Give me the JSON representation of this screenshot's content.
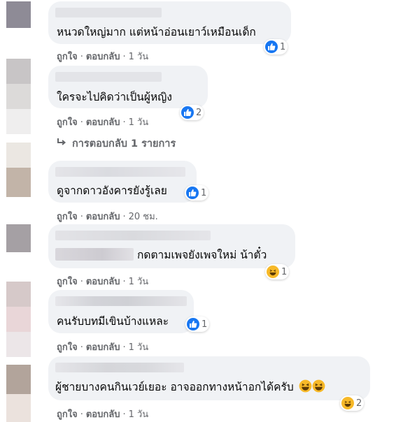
{
  "comments": [
    {
      "text": "หนวดใหญ่มาก แต่หน้าอ่อนเยาว์เหมือนเด็ก",
      "reaction": {
        "icon": "like-icon",
        "count": "1"
      },
      "actions": {
        "like": "ถูกใจ",
        "reply": "ตอบกลับ",
        "time": "1 วัน"
      }
    },
    {
      "text": "ใครจะไปคิดว่าเป็นผู้หญิง",
      "reaction": {
        "icon": "like-icon",
        "count": "2"
      },
      "actions": {
        "like": "ถูกใจ",
        "reply": "ตอบกลับ",
        "time": "1 วัน"
      },
      "replies_link": "การตอบกลับ 1 รายการ"
    },
    {
      "text": "ดูจากดาวอังคารยังรู้เลย",
      "reaction": {
        "icon": "like-icon",
        "count": "1"
      },
      "actions": {
        "like": "ถูกใจ",
        "reply": "ตอบกลับ",
        "time": "20 ชม."
      }
    },
    {
      "text": "กดตามเพจยังเพจใหม่ น้าตั๋ว",
      "reaction": {
        "icon": "haha-icon",
        "count": "1"
      },
      "actions": {
        "like": "ถูกใจ",
        "reply": "ตอบกลับ",
        "time": "1 วัน"
      }
    },
    {
      "text": "คนรับบทมีเขินบ้างแหละ",
      "reaction": {
        "icon": "like-icon",
        "count": "1"
      },
      "actions": {
        "like": "ถูกใจ",
        "reply": "ตอบกลับ",
        "time": "1 วัน"
      }
    },
    {
      "text": "ผู้ชายบางคนกินเวย์เยอะ อาจออกทางหน้าอกได้ครับ",
      "reaction": {
        "icon": "haha-icon",
        "count": "2"
      },
      "actions": {
        "like": "ถูกใจ",
        "reply": "ตอบกลับ",
        "time": "1 วัน"
      }
    }
  ],
  "colors": {
    "bubble": "#f0f2f5",
    "meta_text": "#65676b",
    "like_blue": "#1877f2",
    "haha_yellow": "#f7b928"
  }
}
